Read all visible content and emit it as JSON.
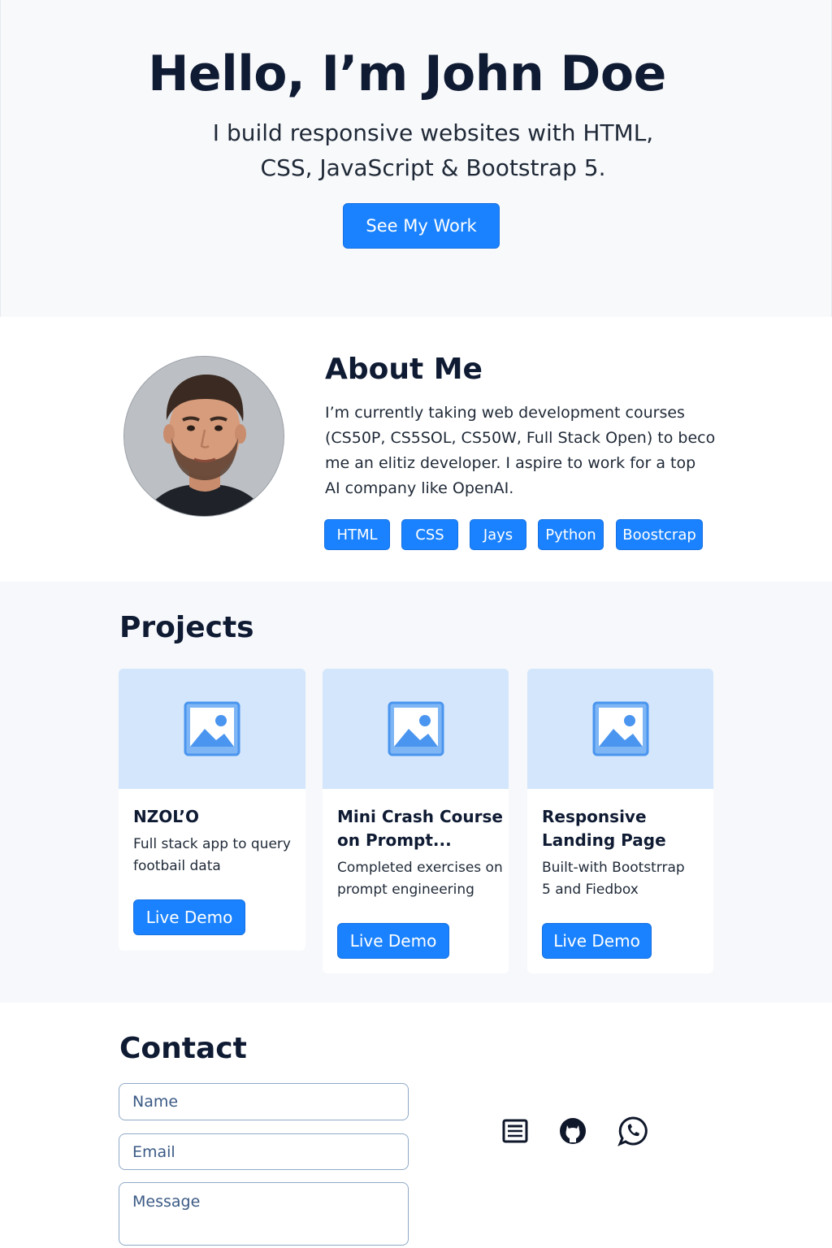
{
  "hero": {
    "title": "Hello, I’m John Doe",
    "subtitle_line1": "I build responsive websites with HTML,",
    "subtitle_line2": "CSS, JavaScript & Bootstrap 5.",
    "cta_label": "See My Work"
  },
  "about": {
    "title": "About Me",
    "text_lines": [
      "I’m currently taking web development courses",
      "(CS50P, CS5SOL, CS50W, Full Stack Open) to beco",
      "me an elitiz developer. I aspire to work for a top",
      "AI company like OpenAI."
    ],
    "skills": [
      "HTML",
      "CSS",
      "Jays",
      "Python",
      "Boostcrap"
    ]
  },
  "projects": {
    "title": "Projects",
    "cards": [
      {
        "title_lines": [
          "NZOL’O"
        ],
        "desc_lines": [
          "Full stack app to query",
          "footbail data"
        ],
        "button_label": "Live Demo"
      },
      {
        "title_lines": [
          "Mini Crash Course",
          "on Prompt..."
        ],
        "desc_lines": [
          "Completed exercises on",
          "prompt engineering"
        ],
        "button_label": "Live Demo"
      },
      {
        "title_lines": [
          "Responsive",
          "Landing Page"
        ],
        "desc_lines": [
          "Built-with Bootstrrap",
          "5 and Fiedbox"
        ],
        "button_label": "Live Demo"
      }
    ]
  },
  "contact": {
    "title": "Contact",
    "name_placeholder": "Name",
    "email_placeholder": "Email",
    "message_placeholder": "Message",
    "social_icons": [
      "document-icon",
      "github-icon",
      "whatsapp-icon"
    ]
  },
  "colors": {
    "accent": "#1a82ff",
    "heading": "#0f1b33",
    "hero_bg": "#f8f9fb",
    "image_placeholder": "#d3e6fb"
  }
}
